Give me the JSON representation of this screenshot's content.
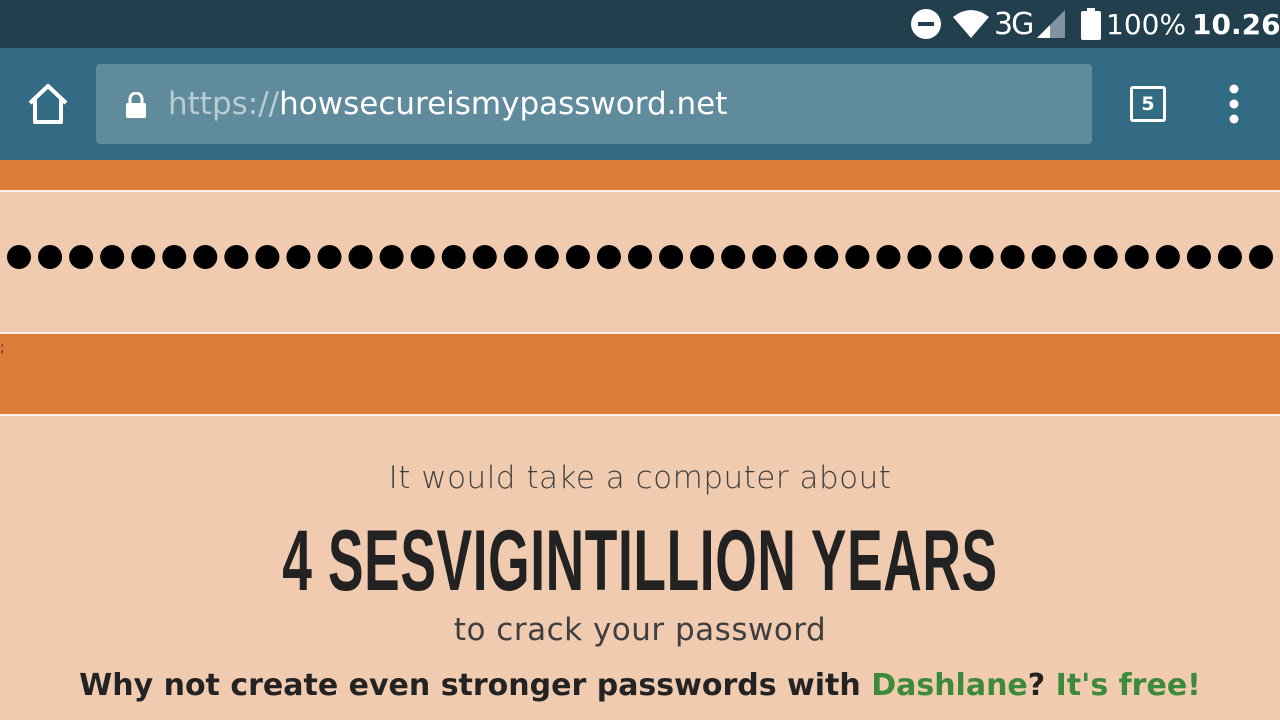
{
  "status_bar": {
    "network": "3G",
    "battery": "100%",
    "time": "10.26",
    "icons": [
      "do-not-disturb-icon",
      "wifi-icon",
      "cell-signal-icon",
      "battery-icon"
    ]
  },
  "browser": {
    "url_scheme": "https://",
    "url_host": "howsecureismypassword.net",
    "tab_count": "5",
    "icons": [
      "home-icon",
      "lock-icon",
      "tabs-icon",
      "overflow-menu-icon"
    ]
  },
  "page": {
    "password_mask_count": 41,
    "mark": ";",
    "line1": "It would take a computer about",
    "time_to_crack": "4 SESVIGINTILLION YEARS",
    "line2": "to crack your password",
    "promo_prefix": "Why not create even stronger passwords with ",
    "promo_link": "Dashlane",
    "promo_mid": "? ",
    "promo_free": "It's free!"
  },
  "colors": {
    "status_bar": "#213f4d",
    "toolbar": "#346b84",
    "url_bar": "#5f8b9c",
    "band": "#db7c38",
    "page_bg": "#f0cbb0",
    "link_green": "#3d8a3c"
  }
}
